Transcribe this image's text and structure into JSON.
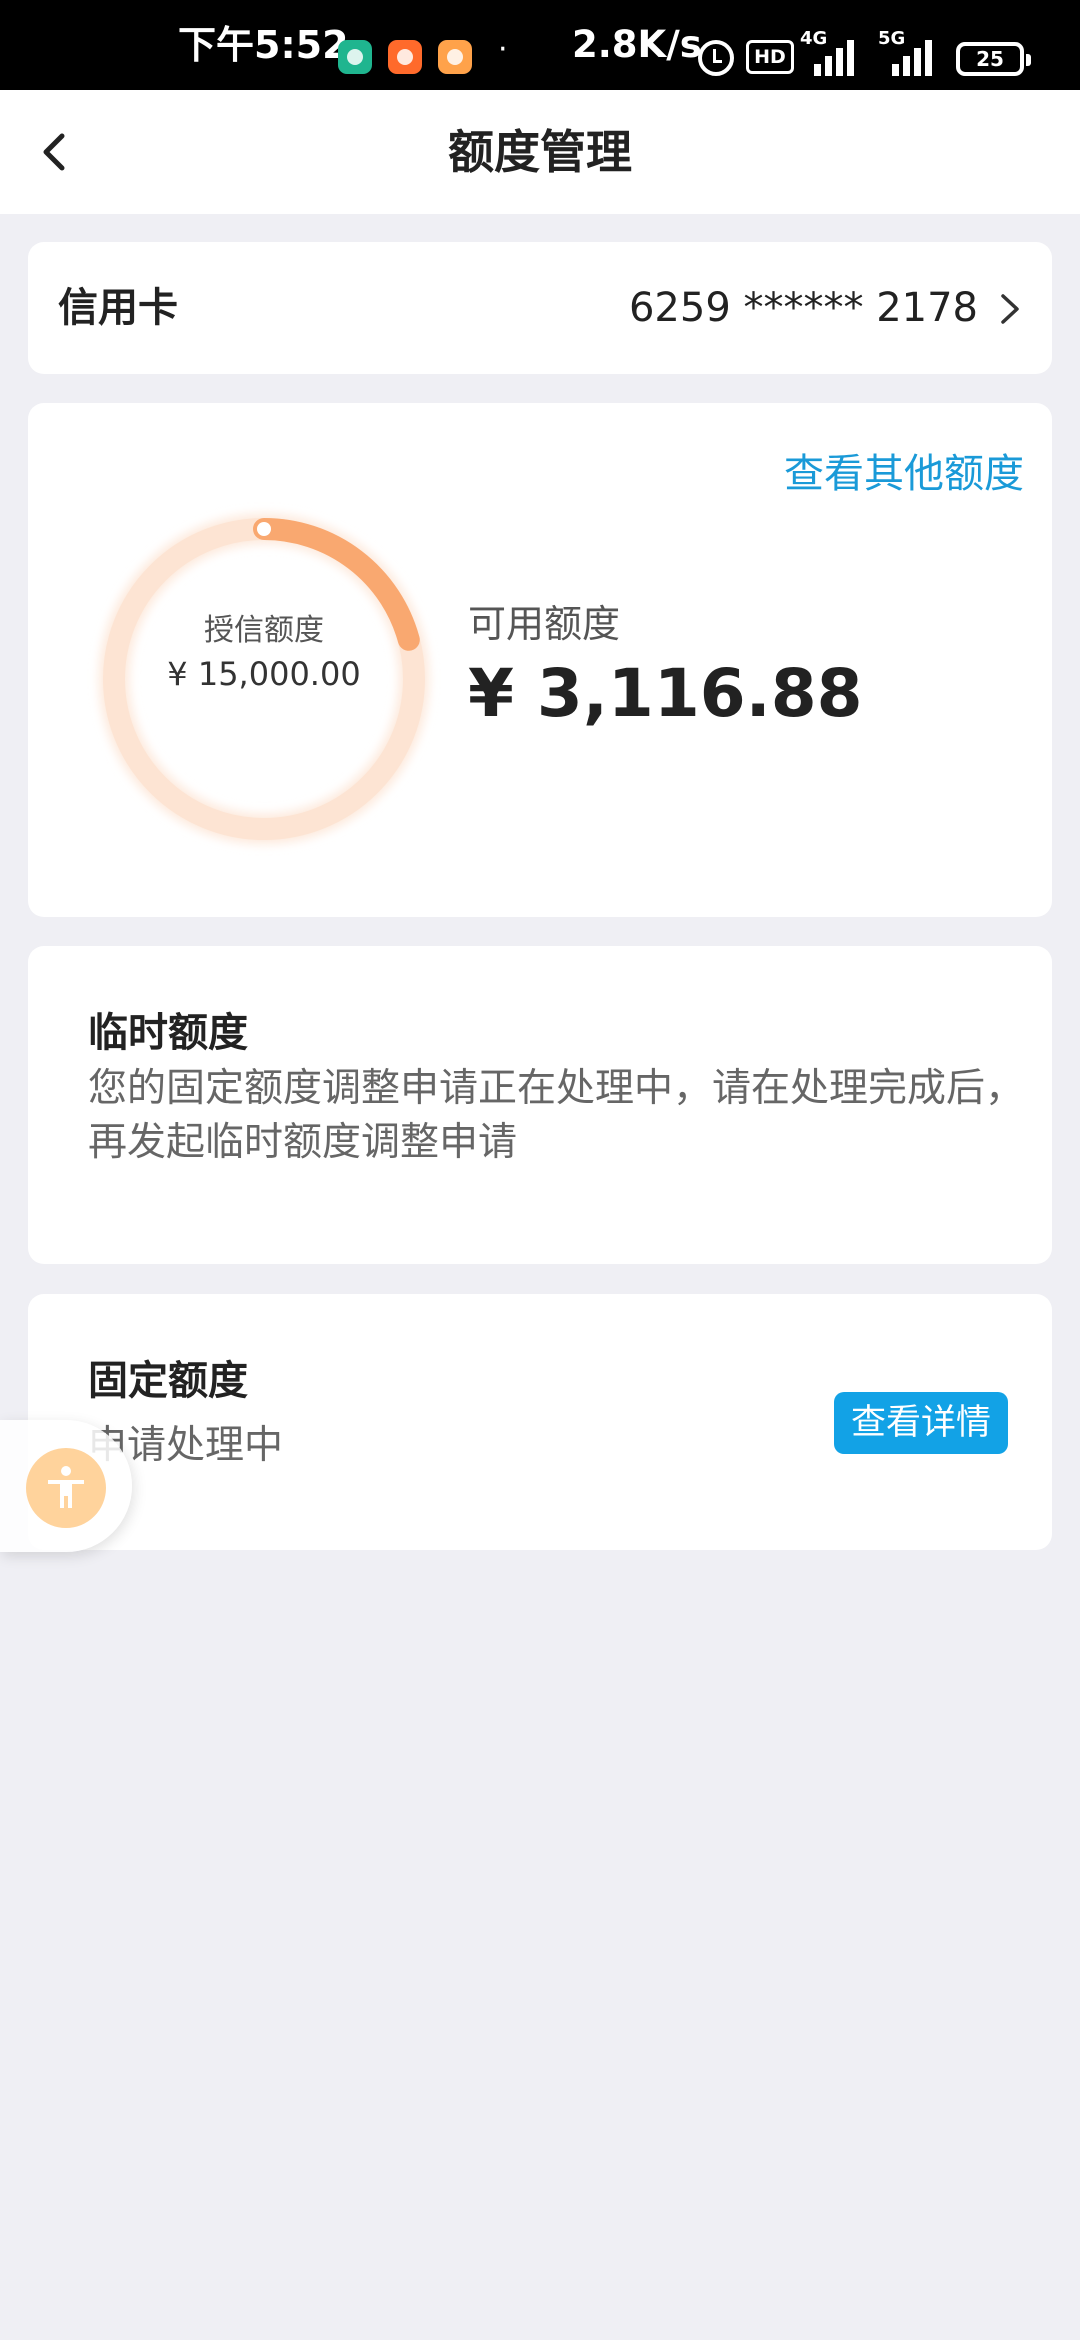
{
  "status_bar": {
    "time": "下午5:52",
    "network_speed": "2.8K/s",
    "hd_label": "HD",
    "net1_label": "4G",
    "net2_label": "5G",
    "battery": "25",
    "dot": "·"
  },
  "header": {
    "title": "额度管理"
  },
  "card_section": {
    "label": "信用卡",
    "card_number": "6259 ****** 2178"
  },
  "limit_section": {
    "view_other_label": "查看其他额度",
    "credit_limit_label": "授信额度",
    "credit_limit_value": "¥ 15,000.00",
    "available_label": "可用额度",
    "available_value": "¥ 3,116.88",
    "available_ratio": 0.2078,
    "ring_track_color": "#fde4d3",
    "ring_fill_color": "#f9a870"
  },
  "temporary_section": {
    "title": "临时额度",
    "description": "您的固定额度调整申请正在处理中，请在处理完成后，再发起临时额度调整申请"
  },
  "fixed_section": {
    "title": "固定额度",
    "status": "申请处理中",
    "detail_button": "查看详情"
  },
  "colors": {
    "accent_blue": "#12a2e6",
    "link_blue": "#1a9ad8",
    "background": "#efeff4"
  }
}
